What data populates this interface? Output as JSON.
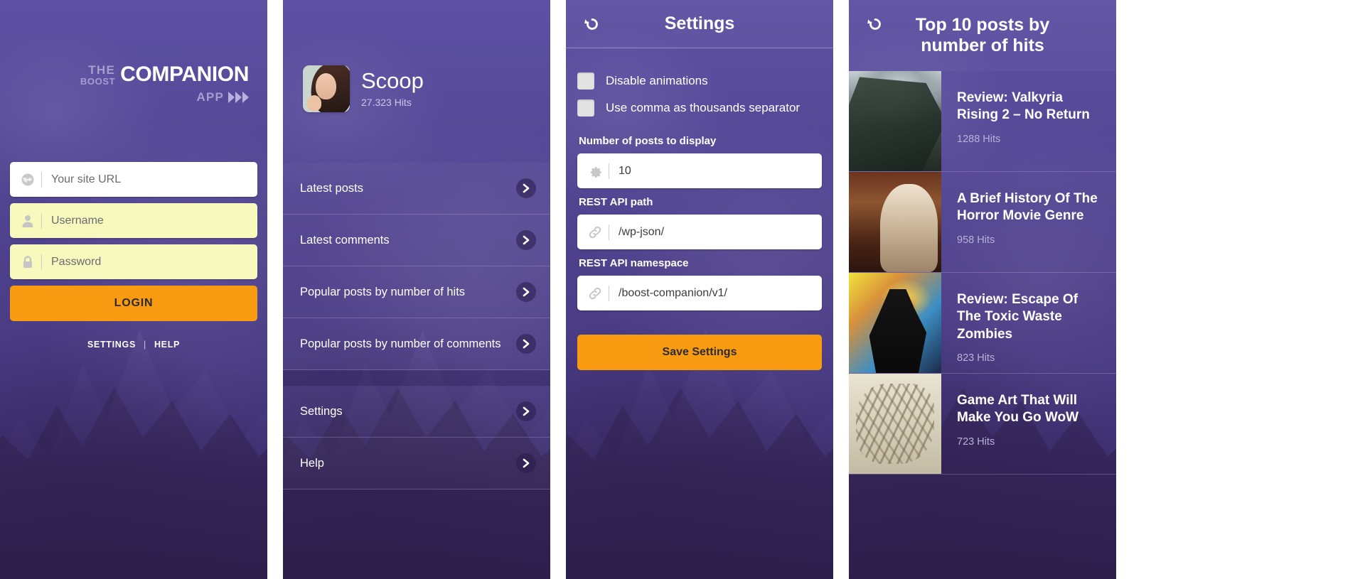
{
  "login": {
    "logo": {
      "the": "THE",
      "boost": "BOOST",
      "main": "COMPANION",
      "app": "APP"
    },
    "fields": [
      {
        "icon": "globe-icon",
        "placeholder": "Your site URL",
        "style": "white",
        "name": "site-url-input"
      },
      {
        "icon": "user-icon",
        "placeholder": "Username",
        "style": "yellow",
        "name": "username-input"
      },
      {
        "icon": "lock-icon",
        "placeholder": "Password",
        "style": "yellow",
        "name": "password-input"
      }
    ],
    "login_button": "LOGIN",
    "settings_link": "SETTINGS",
    "separator": "|",
    "help_link": "HELP"
  },
  "menu": {
    "profile": {
      "name": "Scoop",
      "hits": "27.323 Hits",
      "avatar": "user-avatar"
    },
    "items": [
      {
        "label": "Latest posts"
      },
      {
        "label": "Latest comments"
      },
      {
        "label": "Popular posts by number of hits"
      },
      {
        "label": "Popular posts by number of comments"
      },
      {
        "label": "Settings"
      },
      {
        "label": "Help"
      }
    ]
  },
  "settings": {
    "back_icon": "back-history-icon",
    "title": "Settings",
    "checkboxes": [
      {
        "label": "Disable animations",
        "checked": false
      },
      {
        "label": "Use comma as thousands separator",
        "checked": false
      }
    ],
    "posts_count": {
      "label": "Number of posts to display",
      "icon": "gear-icon",
      "value": "10"
    },
    "api_path": {
      "label": "REST API path",
      "icon": "link-icon",
      "value": "/wp-json/"
    },
    "api_namespace": {
      "label": "REST API namespace",
      "icon": "link-icon",
      "value": "/boost-companion/v1/"
    },
    "save_button": "Save Settings"
  },
  "top_posts": {
    "back_icon": "back-history-icon",
    "title": "Top 10 posts by number of hits",
    "items": [
      {
        "title": "Review: Valkyria Rising 2 – No Return",
        "hits": "1288 Hits",
        "art": "art-valkyria"
      },
      {
        "title": "A Brief History Of The Horror Movie Genre",
        "hits": "958 Hits",
        "art": "art-horror"
      },
      {
        "title": "Review: Escape Of The Toxic Waste Zombies",
        "hits": "823 Hits",
        "art": "art-zombie"
      },
      {
        "title": "Game Art That Will Make You Go WoW",
        "hits": "723 Hits",
        "art": "art-gameart"
      }
    ]
  },
  "colors": {
    "purple": "#584a9e",
    "orange": "#f99b11",
    "yellow_field": "#f8f9bd",
    "white": "#ffffff"
  }
}
